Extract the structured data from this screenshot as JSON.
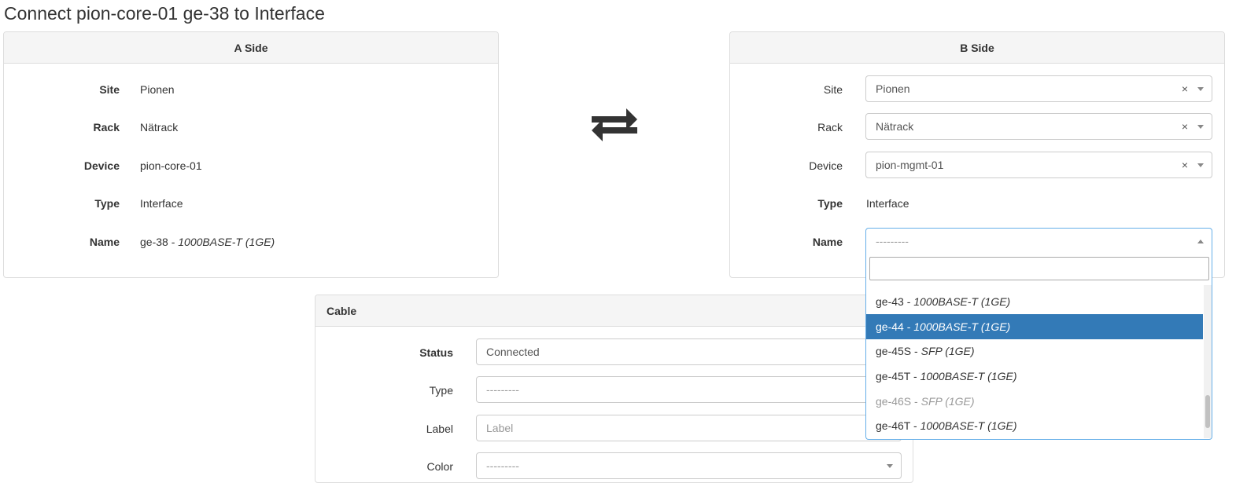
{
  "title": "Connect pion-core-01 ge-38 to Interface",
  "a_side": {
    "heading": "A Side",
    "rows": [
      {
        "label": "Site",
        "value": "Pionen"
      },
      {
        "label": "Rack",
        "value": "Nätrack"
      },
      {
        "label": "Device",
        "value": "pion-core-01"
      },
      {
        "label": "Type",
        "value": "Interface"
      },
      {
        "label": "Name",
        "value": "ge-38",
        "sep": " - ",
        "detail": "1000BASE-T (1GE)"
      }
    ]
  },
  "swap_icon": "swap-arrows-icon",
  "b_side": {
    "heading": "B Side",
    "site": {
      "label": "Site",
      "value": "Pionen",
      "clear": "×"
    },
    "rack": {
      "label": "Rack",
      "value": "Nätrack",
      "clear": "×"
    },
    "device": {
      "label": "Device",
      "value": "pion-mgmt-01",
      "clear": "×"
    },
    "type": {
      "label": "Type",
      "value": "Interface"
    },
    "name": {
      "label": "Name",
      "placeholder": "---------"
    },
    "dropdown": {
      "search_value": "",
      "options": [
        {
          "name": "ge-43",
          "sep": " - ",
          "detail": "1000BASE-T (1GE)",
          "state": "normal"
        },
        {
          "name": "ge-44",
          "sep": " - ",
          "detail": "1000BASE-T (1GE)",
          "state": "highlight"
        },
        {
          "name": "ge-45S",
          "sep": " - ",
          "detail": "SFP (1GE)",
          "state": "normal"
        },
        {
          "name": "ge-45T",
          "sep": " - ",
          "detail": "1000BASE-T (1GE)",
          "state": "normal"
        },
        {
          "name": "ge-46S",
          "sep": " - ",
          "detail": "SFP (1GE)",
          "state": "disabled"
        },
        {
          "name": "ge-46T",
          "sep": " - ",
          "detail": "1000BASE-T (1GE)",
          "state": "normal"
        }
      ]
    }
  },
  "cable": {
    "heading": "Cable",
    "status": {
      "label": "Status",
      "value": "Connected"
    },
    "type": {
      "label": "Type",
      "placeholder": "---------"
    },
    "label": {
      "label": "Label",
      "placeholder": "Label"
    },
    "color": {
      "label": "Color",
      "placeholder": "---------"
    }
  },
  "colors": {
    "highlight": "#337ab7",
    "focus_border": "#66afe9",
    "panel_heading_bg": "#f5f5f5"
  }
}
